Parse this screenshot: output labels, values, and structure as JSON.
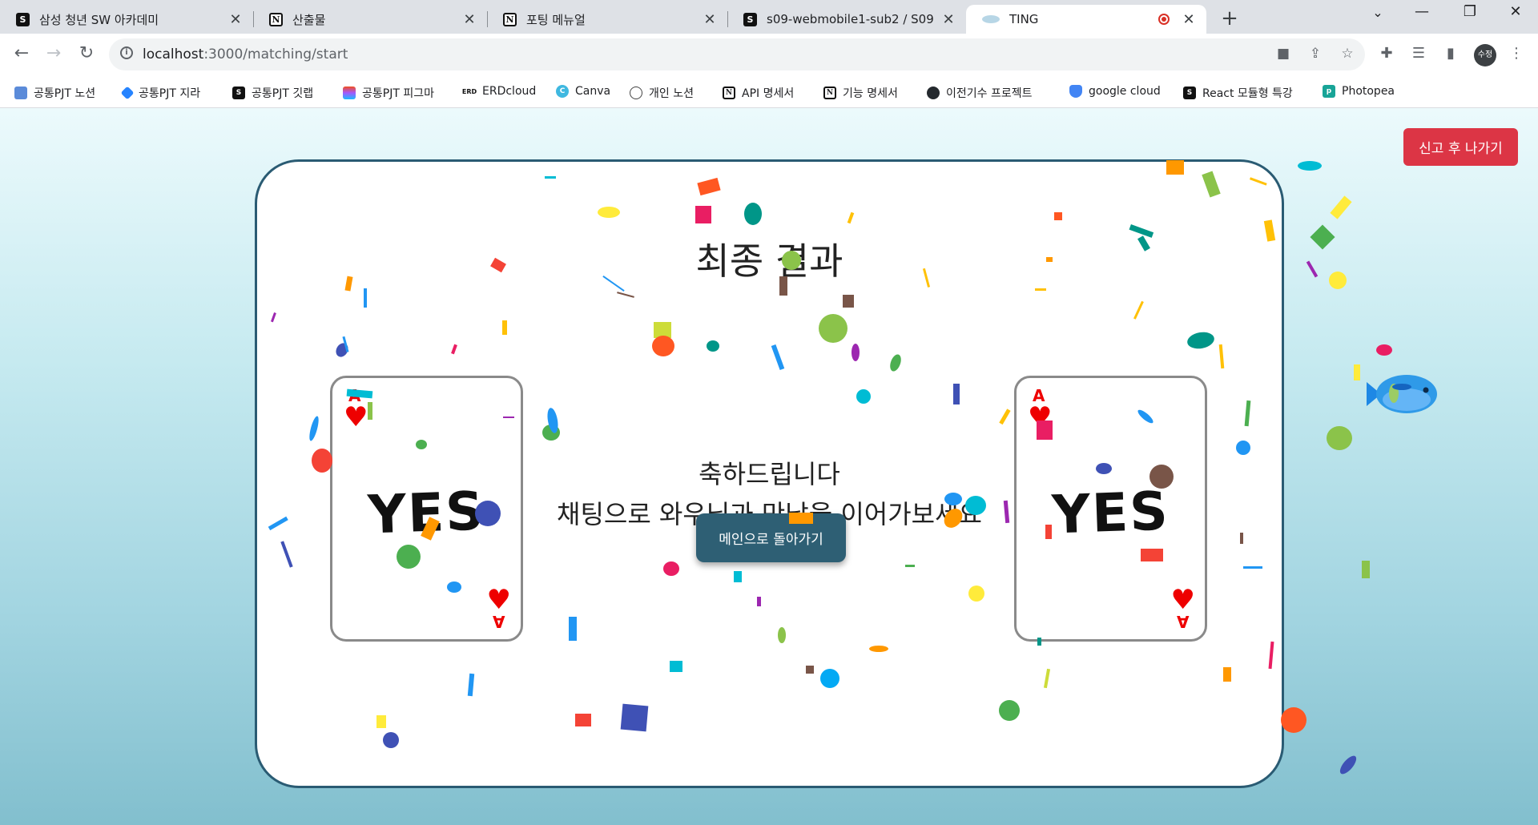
{
  "browser": {
    "tabs": [
      {
        "title": "삼성 청년 SW 아카데미",
        "icon": "ssafy-icon",
        "active": false
      },
      {
        "title": "산출물",
        "icon": "notion-icon",
        "active": false
      },
      {
        "title": "포팅 메뉴얼",
        "icon": "notion-icon",
        "active": false
      },
      {
        "title": "s09-webmobile1-sub2 / S09P12",
        "icon": "ssafy-icon",
        "active": false
      },
      {
        "title": "TING",
        "icon": "ting-icon",
        "active": true
      }
    ],
    "new_tab": "+",
    "url_host": "localhost",
    "url_path": ":3000/matching/start",
    "profile": "수정",
    "bookmarks": [
      {
        "label": "공통PJT 노션",
        "icon": "laptop-icon"
      },
      {
        "label": "공통PJT 지라",
        "icon": "jira-icon"
      },
      {
        "label": "공통PJT 깃랩",
        "icon": "ssafy-icon"
      },
      {
        "label": "공통PJT 피그마",
        "icon": "figma-icon"
      },
      {
        "label": "ERDcloud",
        "icon": "erd-icon"
      },
      {
        "label": "Canva",
        "icon": "canva-icon"
      },
      {
        "label": "개인 노션",
        "icon": "globe-icon"
      },
      {
        "label": "API 명세서",
        "icon": "notion-icon"
      },
      {
        "label": "기능 명세서",
        "icon": "notion-icon"
      },
      {
        "label": "이전기수 프로젝트",
        "icon": "github-icon"
      },
      {
        "label": "google cloud",
        "icon": "shield-icon"
      },
      {
        "label": "React 모듈형 특강",
        "icon": "ssafy-icon"
      },
      {
        "label": "Photopea",
        "icon": "photopea-icon"
      }
    ]
  },
  "page": {
    "report_button": "신고 후 나가기",
    "title": "최종 결과",
    "message_line1": "축하드립니다",
    "message_line2": "채팅으로 와우님과 만남을 이어가보세요",
    "home_button": "메인으로 돌아가기",
    "cards": [
      {
        "rank": "A",
        "suit": "♥",
        "text": "YES"
      },
      {
        "rank": "A",
        "suit": "♥",
        "text": "YES"
      }
    ],
    "colors": {
      "report": "#dc3545",
      "home": "#2e5f74",
      "panel_border": "#2a5b73",
      "suit": "#e00000"
    }
  }
}
